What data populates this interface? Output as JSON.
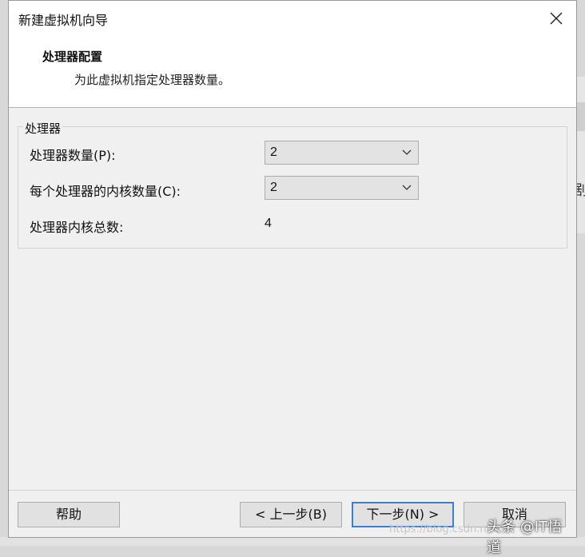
{
  "window": {
    "title": "新建虚拟机向导",
    "close_icon": "close-icon"
  },
  "header": {
    "title": "处理器配置",
    "description": "为此虚拟机指定处理器数量。"
  },
  "processor_group": {
    "legend": "处理器",
    "processor_count": {
      "label": "处理器数量(P):",
      "value": "2"
    },
    "cores_per_processor": {
      "label": "每个处理器的内核数量(C):",
      "value": "2"
    },
    "total_cores": {
      "label": "处理器内核总数:",
      "value": "4"
    }
  },
  "buttons": {
    "help": "帮助",
    "back": "< 上一步(B)",
    "next": "下一步(N) >",
    "cancel": "取消"
  },
  "watermark": {
    "url": "https://blog.csdn.net/",
    "text": "头条 @IT悟道"
  },
  "background": {
    "glyph": "剧"
  },
  "colors": {
    "dialog_bg": "#f0f0f0",
    "header_bg": "#ffffff",
    "primary_button_border": "#3c7fd1"
  }
}
